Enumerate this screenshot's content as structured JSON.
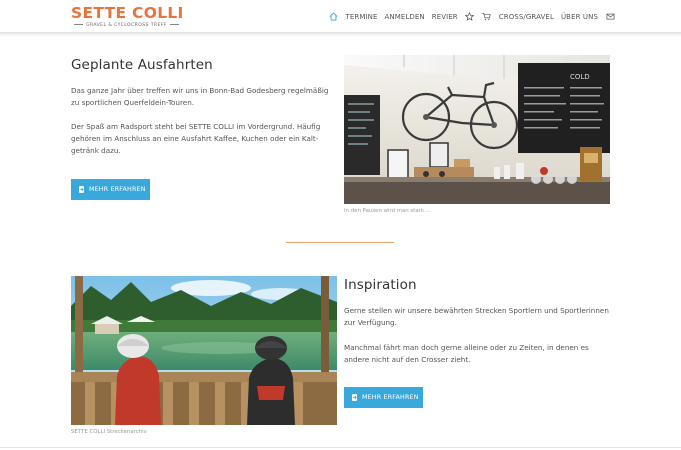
{
  "header": {
    "logo_title": "SETTE COLLI",
    "logo_subtitle": "GRAVEL & CYCLOCROSS TREFF",
    "nav": {
      "home_icon": "home-icon",
      "items": [
        "TERMINE",
        "ANMELDEN",
        "REVIER"
      ],
      "star_icon": "star-icon",
      "cart_icon": "cart-icon",
      "items2": [
        "CROSS/GRAVEL",
        "ÜBER UNS"
      ],
      "mail_icon": "envelope-icon"
    }
  },
  "section1": {
    "title": "Geplante Ausfahrten",
    "paragraph1": "Das ganze Jahr über treffen wir uns in Bonn-Bad Godesberg regelmä­ßig zu sportlichen Querfeldein-Touren.",
    "paragraph2": "Der Spaß am Radsport steht bei SETTE COLLI im Vordergrund. Häufig gehören im Anschluss an eine Ausfahrt Kaffee, Kuchen oder ein Kalt­getränk dazu.",
    "button_label": "MEHR ERFAHREN",
    "image_caption": "In den Pausen wird man stark ..."
  },
  "section2": {
    "title": "Inspiration",
    "paragraph1": "Gerne stellen wir unsere bewährten Strecken Sportlern und Sportle­rinnen zur Verfügung.",
    "paragraph2": "Manchmal fährt man doch gerne alleine oder zu Zeiten, in denen es andere nicht auf den Crosser zieht.",
    "button_label": "MEHR ERFAHREN",
    "image_caption": "SETTE COLLI Streckenarchiv"
  },
  "colors": {
    "brand_orange": "#e8743b",
    "button_blue": "#39a9dc",
    "nav_active": "#39a9dc",
    "divider": "#e8a36e"
  }
}
